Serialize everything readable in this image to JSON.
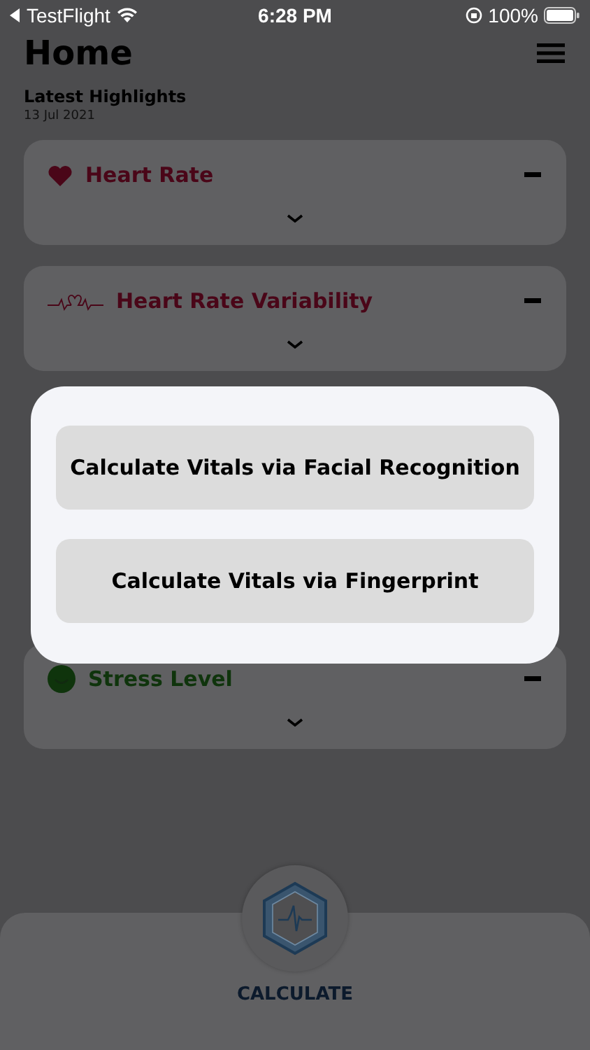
{
  "status_bar": {
    "back_app": "TestFlight",
    "time": "6:28 PM",
    "battery": "100%"
  },
  "header": {
    "title": "Home"
  },
  "highlights": {
    "title": "Latest Highlights",
    "date": "13 Jul 2021"
  },
  "cards": [
    {
      "kind": "heart",
      "title": "Heart Rate",
      "color": "#4a0618"
    },
    {
      "kind": "ecg",
      "title": "Heart Rate Variability",
      "color": "#4a0618"
    },
    {
      "kind": "smiley",
      "title": "Stress Level",
      "color": "#0f340c"
    }
  ],
  "dialog": {
    "buttons": [
      "Calculate Vitals via Facial Recognition",
      "Calculate Vitals via Fingerprint"
    ]
  },
  "bottom_bar": {
    "label": "CALCULATE"
  }
}
